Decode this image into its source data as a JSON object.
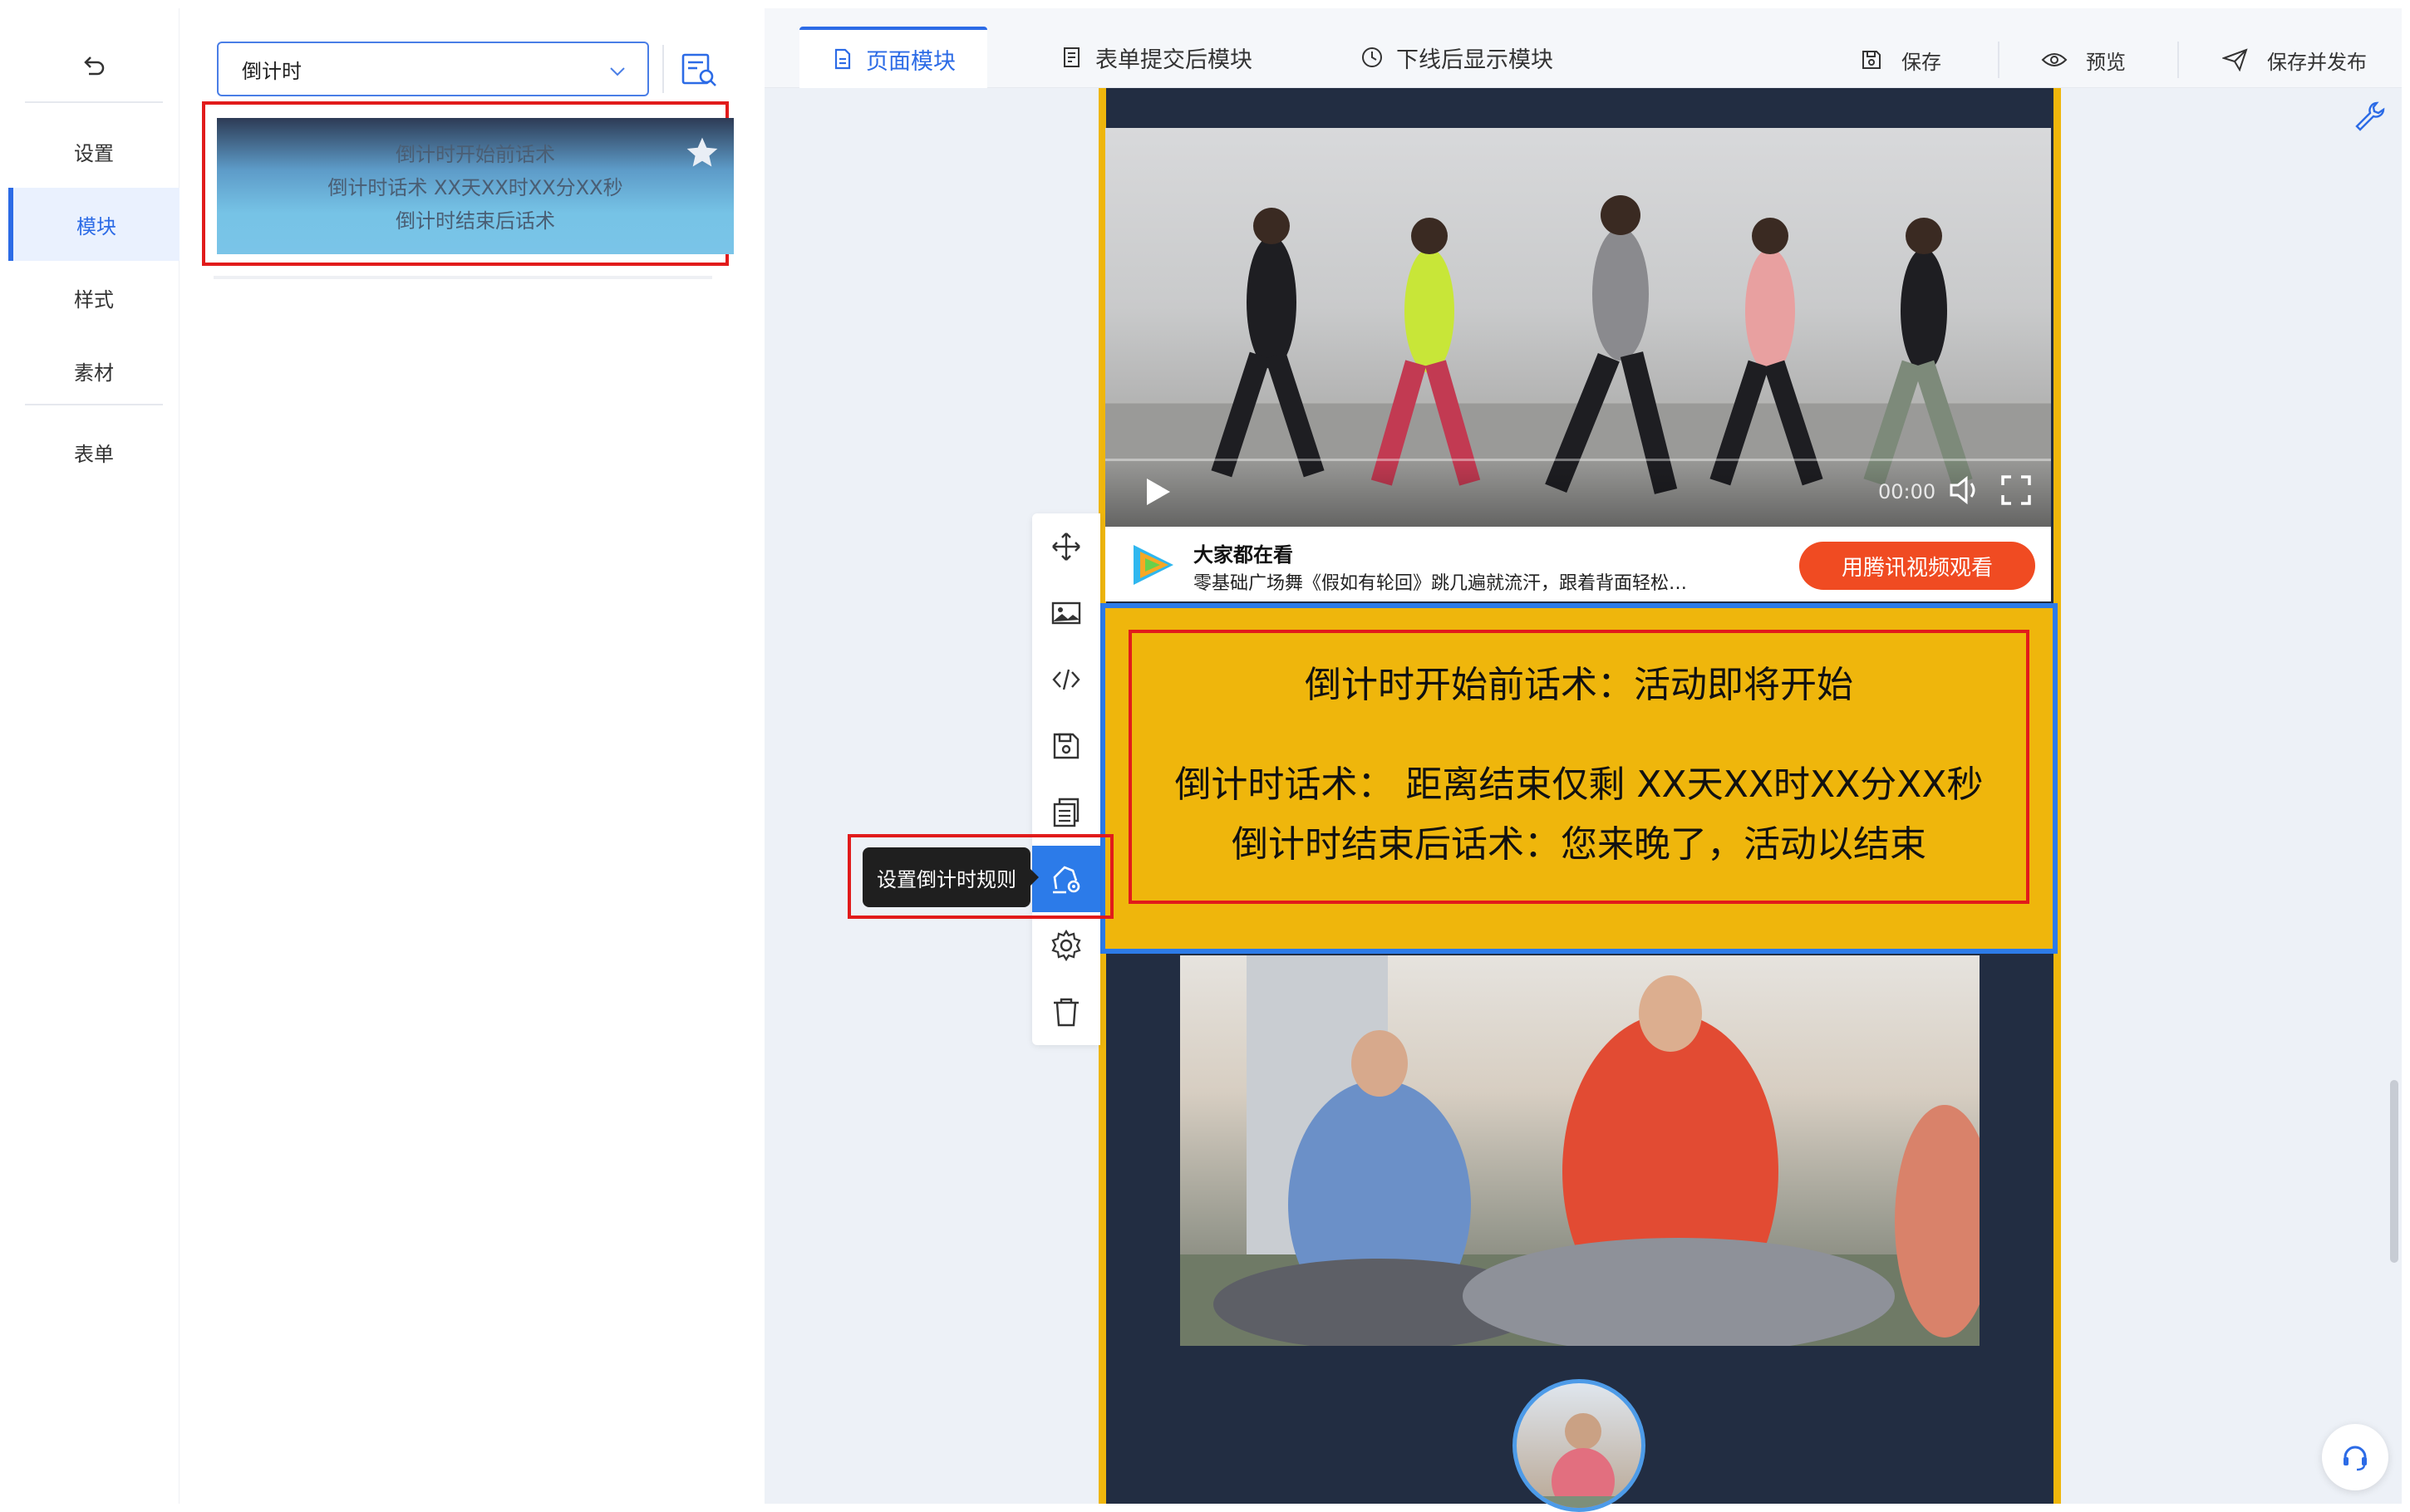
{
  "nav": {
    "back_icon": "back-icon",
    "items": [
      "设置",
      "模块",
      "样式",
      "素材",
      "表单"
    ],
    "active_index": 1
  },
  "module_panel": {
    "select_value": "倒计时",
    "template_search_icon": "template-search-icon",
    "preview": {
      "line1": "倒计时开始前话术",
      "line2": "倒计时话术 XX天XX时XX分XX秒",
      "line3": "倒计时结束后话术",
      "star_icon": "star-icon"
    }
  },
  "tabs": [
    {
      "label": "页面模块",
      "icon": "page-icon",
      "active": true
    },
    {
      "label": "表单提交后模块",
      "icon": "form-doc-icon",
      "active": false
    },
    {
      "label": "下线后显示模块",
      "icon": "clock-icon",
      "active": false
    }
  ],
  "actions": {
    "save": "保存",
    "preview": "预览",
    "publish": "保存并发布"
  },
  "canvas": {
    "video": {
      "time": "00:00"
    },
    "tencent_bar": {
      "title": "大家都在看",
      "desc": "零基础广场舞《假如有轮回》跳几遍就流汗，跟着背面轻松…",
      "button": "用腾讯视频观看"
    },
    "countdown": {
      "before": "倒计时开始前话术：活动即将开始",
      "during": "倒计时话术： 距离结束仅剩 XX天XX时XX分XX秒",
      "after": "倒计时结束后话术：您来晚了，活动以结束"
    }
  },
  "toolbar": {
    "tools": [
      "move-icon",
      "image-icon",
      "code-icon",
      "save-module-icon",
      "copy-icon",
      "countdown-rules-icon",
      "settings-icon",
      "delete-icon"
    ],
    "active_index": 5,
    "tooltip": "设置倒计时规则"
  },
  "colors": {
    "primary": "#2c6be6",
    "canvas_bg": "#222d42",
    "countdown_bg": "#efb60c",
    "highlight_red": "#e11b1b",
    "tencent_button": "#f04b22"
  }
}
